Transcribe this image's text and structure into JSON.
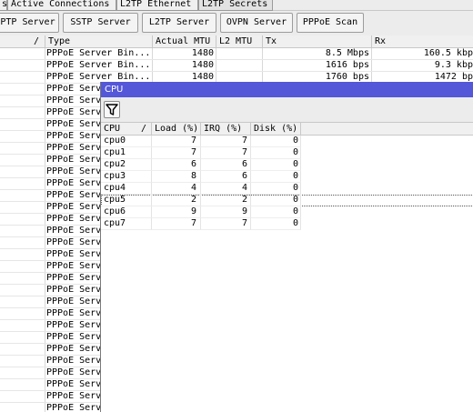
{
  "tabs": [
    "s",
    "Active Connections",
    "L2TP Ethernet",
    "L2TP Secrets"
  ],
  "buttons": [
    "PTP Server",
    "SSTP Server",
    "L2TP Server",
    "OVPN Server",
    "PPPoE Scan"
  ],
  "main_table": {
    "headers": {
      "name": "/",
      "type": "Type",
      "actual_mtu": "Actual MTU",
      "l2_mtu": "L2 MTU",
      "tx": "Tx",
      "rx": "Rx"
    },
    "rows": [
      {
        "type": "PPPoE Server Bin...",
        "actual_mtu": "1480",
        "tx": "8.5 Mbps",
        "rx": "160.5 kbp"
      },
      {
        "type": "PPPoE Server Bin...",
        "actual_mtu": "1480",
        "tx": "1616 bps",
        "rx": "9.3 kbp"
      },
      {
        "type": "PPPoE Server Bin...",
        "actual_mtu": "1480",
        "tx": "1760 bps",
        "rx": "1472 bp"
      },
      {
        "type": "PPPoE Serv"
      },
      {
        "type": "PPPoE Serv"
      },
      {
        "type": "PPPoE Serv"
      },
      {
        "type": "PPPoE Serv"
      },
      {
        "type": "PPPoE Serv"
      },
      {
        "type": "PPPoE Serv"
      },
      {
        "type": "PPPoE Serv"
      },
      {
        "type": "PPPoE Serv"
      },
      {
        "type": "PPPoE Serv"
      },
      {
        "type": "PPPoE Serv"
      },
      {
        "type": "PPPoE Serv"
      },
      {
        "type": "PPPoE Serv"
      },
      {
        "type": "PPPoE Serv"
      },
      {
        "type": "PPPoE Serv"
      },
      {
        "type": "PPPoE Serv"
      },
      {
        "type": "PPPoE Serv"
      },
      {
        "type": "PPPoE Serv"
      },
      {
        "type": "PPPoE Serv"
      },
      {
        "type": "PPPoE Serv"
      },
      {
        "type": "PPPoE Serv"
      },
      {
        "type": "PPPoE Serv"
      },
      {
        "type": "PPPoE Serv"
      },
      {
        "type": "PPPoE Serv"
      },
      {
        "type": "PPPoE Serv"
      },
      {
        "type": "PPPoE Serv"
      },
      {
        "type": "PPPoE Serv"
      },
      {
        "type": "PPPoE Serv"
      },
      {
        "type": "PPPoE Serv"
      }
    ]
  },
  "cpu_window": {
    "title": "CPU",
    "filter_icon": "funnel-icon",
    "headers": {
      "cpu": "CPU",
      "sort": "/",
      "load": "Load (%)",
      "irq": "IRQ (%)",
      "disk": "Disk (%)"
    },
    "rows": [
      {
        "cpu": "cpu0",
        "load": "7",
        "irq": "7",
        "disk": "0"
      },
      {
        "cpu": "cpu1",
        "load": "7",
        "irq": "7",
        "disk": "0"
      },
      {
        "cpu": "cpu2",
        "load": "6",
        "irq": "6",
        "disk": "0"
      },
      {
        "cpu": "cpu3",
        "load": "8",
        "irq": "6",
        "disk": "0"
      },
      {
        "cpu": "cpu4",
        "load": "4",
        "irq": "4",
        "disk": "0"
      },
      {
        "cpu": "cpu5",
        "load": "2",
        "irq": "2",
        "disk": "0"
      },
      {
        "cpu": "cpu6",
        "load": "9",
        "irq": "9",
        "disk": "0"
      },
      {
        "cpu": "cpu7",
        "load": "7",
        "irq": "7",
        "disk": "0"
      }
    ],
    "selected_row": "cpu5"
  },
  "colors": {
    "title_bar": "#5457d8",
    "toolbar": "#ececec"
  }
}
